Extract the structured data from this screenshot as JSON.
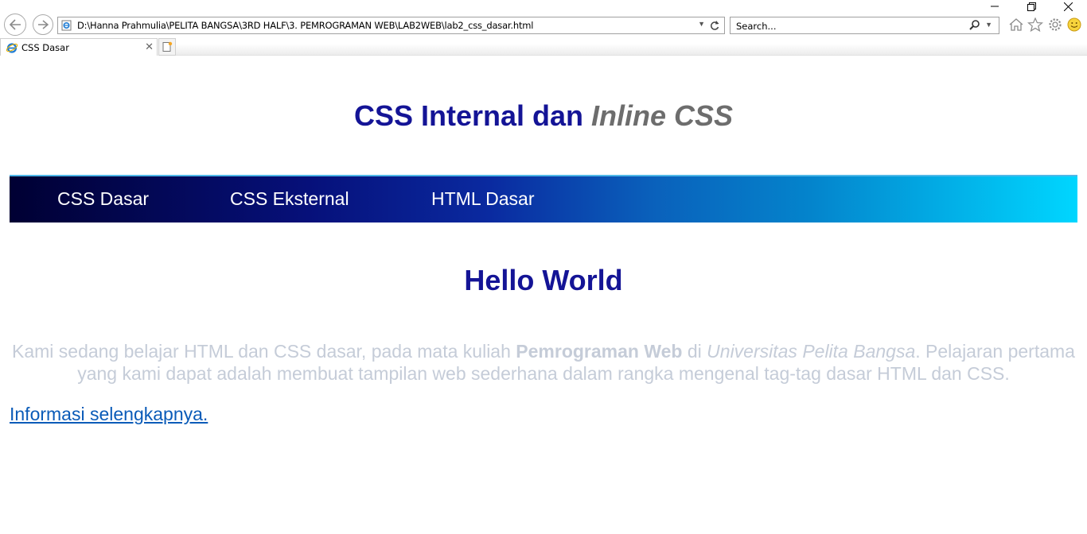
{
  "browser": {
    "address_url": "D:\\Hanna Prahmulia\\PELITA BANGSA\\3RD HALF\\3. PEMROGRAMAN WEB\\LAB2WEB\\lab2_css_dasar.html",
    "search_placeholder": "Search...",
    "tab_title": "CSS Dasar"
  },
  "page": {
    "title_main": "CSS Internal dan ",
    "title_italic": "Inline CSS",
    "nav": [
      {
        "label": "CSS Dasar"
      },
      {
        "label": "CSS Eksternal"
      },
      {
        "label": "HTML Dasar"
      }
    ],
    "heading": "Hello World",
    "paragraph": {
      "part1": "Kami sedang belajar HTML dan CSS dasar, pada mata kuliah ",
      "bold": "Pemrograman Web",
      "part2": " di ",
      "italic": "Universitas Pelita Bangsa",
      "part3": ". Pelajaran pertama yang kami dapat adalah membuat tampilan web sederhana dalam rangka mengenal tag-tag dasar HTML dan CSS."
    },
    "link": "Informasi selengkapnya."
  },
  "colors": {
    "heading": "#141496",
    "title_italic": "#6d6d6d",
    "paragraph": "#c5ccd8",
    "link": "#0a5bb8",
    "nav_gradient_start": "#000033",
    "nav_gradient_end": "#00d6ff"
  }
}
